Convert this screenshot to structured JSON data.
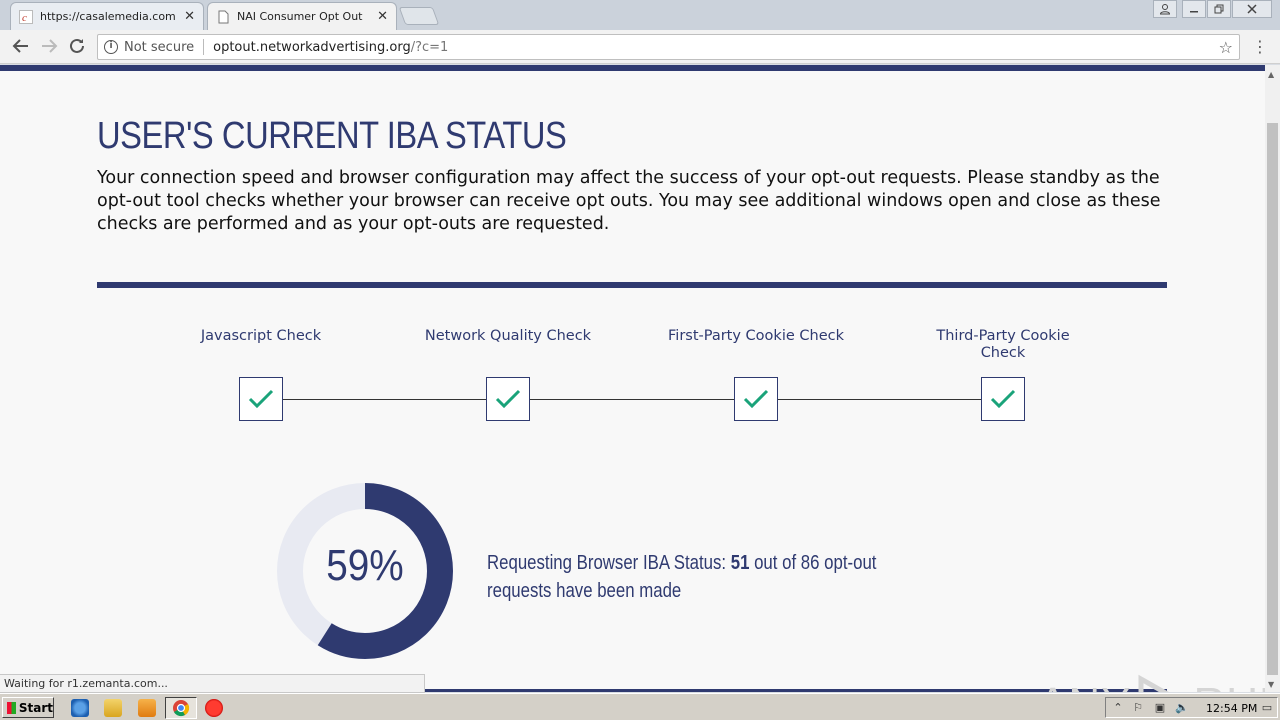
{
  "browser": {
    "tabs": [
      {
        "label": "https://casalemedia.com",
        "close": "✕"
      },
      {
        "label": "NAI Consumer Opt Out",
        "close": "✕"
      }
    ],
    "address": {
      "security": "Not secure",
      "host": "optout.networkadvertising.org",
      "path": "/?c=1"
    },
    "status_bubble": "Waiting for r1.zemanta.com..."
  },
  "page": {
    "title": "USER'S CURRENT IBA STATUS",
    "description": "Your connection speed and browser configuration may affect the success of your opt-out requests. Please standby as the opt-out tool checks whether your browser can receive opt outs. You may see additional windows open and close as these checks are performed and as your opt-outs are requested.",
    "checks": [
      {
        "label": "Javascript Check",
        "status": "passed"
      },
      {
        "label": "Network Quality Check",
        "status": "passed"
      },
      {
        "label": "First-Party Cookie Check",
        "status": "passed"
      },
      {
        "label": "Third-Party Cookie Check",
        "status": "passed"
      }
    ],
    "progress": {
      "percent_label": "59%",
      "fraction": 0.59,
      "status_prefix": "Requesting Browser IBA Status:",
      "done": "51",
      "middle": "out of",
      "total": "86",
      "status_suffix": "opt-out requests have been made"
    },
    "colors": {
      "navy": "#2f3a70",
      "check": "#1aa37a",
      "ring_bg": "#e8eaf2"
    }
  },
  "watermark": {
    "left": "ANY",
    "right": "RUN"
  },
  "taskbar": {
    "start_label": "Start",
    "clock": "12:54 PM"
  }
}
